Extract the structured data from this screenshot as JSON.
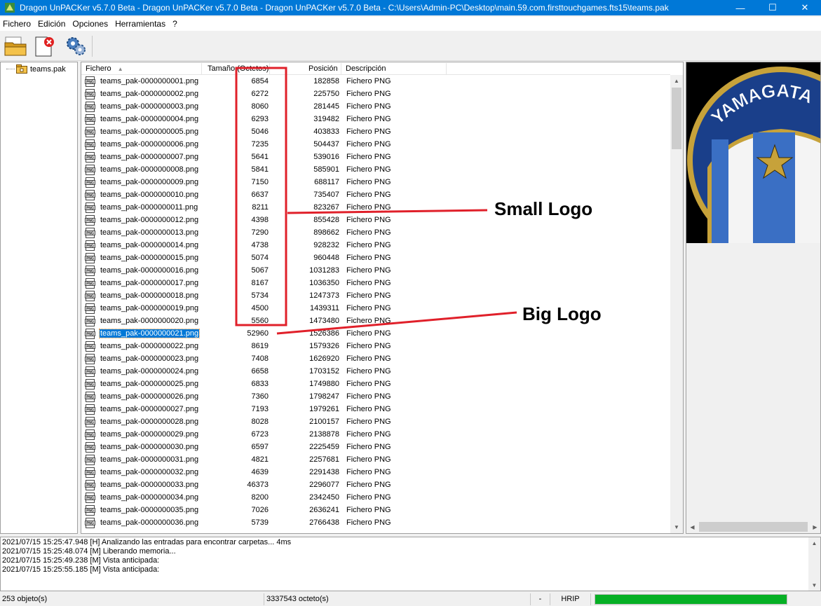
{
  "window": {
    "title": "Dragon UnPACKer v5.7.0 Beta - Dragon UnPACKer v5.7.0 Beta - Dragon UnPACKer v5.7.0 Beta - C:\\Users\\Admin-PC\\Desktop\\main.59.com.firsttouchgames.fts15\\teams.pak",
    "minimize": "—",
    "maximize": "☐",
    "close": "✕"
  },
  "menu": [
    "Fichero",
    "Edición",
    "Opciones",
    "Herramientas",
    "?"
  ],
  "toolbar": {
    "icons": [
      "open-folder-icon",
      "close-file-icon",
      "options-gear-icon"
    ]
  },
  "tree": {
    "root": "teams.pak"
  },
  "columns": {
    "name": "Fichero",
    "size": "Tamaño (Octetos)",
    "position": "Posición",
    "description": "Descripción"
  },
  "files": [
    {
      "name": "teams_pak-0000000001.png",
      "size": "6854",
      "pos": "182858",
      "desc": "Fichero PNG"
    },
    {
      "name": "teams_pak-0000000002.png",
      "size": "6272",
      "pos": "225750",
      "desc": "Fichero PNG"
    },
    {
      "name": "teams_pak-0000000003.png",
      "size": "8060",
      "pos": "281445",
      "desc": "Fichero PNG"
    },
    {
      "name": "teams_pak-0000000004.png",
      "size": "6293",
      "pos": "319482",
      "desc": "Fichero PNG"
    },
    {
      "name": "teams_pak-0000000005.png",
      "size": "5046",
      "pos": "403833",
      "desc": "Fichero PNG"
    },
    {
      "name": "teams_pak-0000000006.png",
      "size": "7235",
      "pos": "504437",
      "desc": "Fichero PNG"
    },
    {
      "name": "teams_pak-0000000007.png",
      "size": "5641",
      "pos": "539016",
      "desc": "Fichero PNG"
    },
    {
      "name": "teams_pak-0000000008.png",
      "size": "5841",
      "pos": "585901",
      "desc": "Fichero PNG"
    },
    {
      "name": "teams_pak-0000000009.png",
      "size": "7150",
      "pos": "688117",
      "desc": "Fichero PNG"
    },
    {
      "name": "teams_pak-0000000010.png",
      "size": "6637",
      "pos": "735407",
      "desc": "Fichero PNG"
    },
    {
      "name": "teams_pak-0000000011.png",
      "size": "8211",
      "pos": "823267",
      "desc": "Fichero PNG"
    },
    {
      "name": "teams_pak-0000000012.png",
      "size": "4398",
      "pos": "855428",
      "desc": "Fichero PNG"
    },
    {
      "name": "teams_pak-0000000013.png",
      "size": "7290",
      "pos": "898662",
      "desc": "Fichero PNG"
    },
    {
      "name": "teams_pak-0000000014.png",
      "size": "4738",
      "pos": "928232",
      "desc": "Fichero PNG"
    },
    {
      "name": "teams_pak-0000000015.png",
      "size": "5074",
      "pos": "960448",
      "desc": "Fichero PNG"
    },
    {
      "name": "teams_pak-0000000016.png",
      "size": "5067",
      "pos": "1031283",
      "desc": "Fichero PNG"
    },
    {
      "name": "teams_pak-0000000017.png",
      "size": "8167",
      "pos": "1036350",
      "desc": "Fichero PNG"
    },
    {
      "name": "teams_pak-0000000018.png",
      "size": "5734",
      "pos": "1247373",
      "desc": "Fichero PNG"
    },
    {
      "name": "teams_pak-0000000019.png",
      "size": "4500",
      "pos": "1439311",
      "desc": "Fichero PNG"
    },
    {
      "name": "teams_pak-0000000020.png",
      "size": "5560",
      "pos": "1473480",
      "desc": "Fichero PNG"
    },
    {
      "name": "teams_pak-0000000021.png",
      "size": "52960",
      "pos": "1526386",
      "desc": "Fichero PNG",
      "selected": true
    },
    {
      "name": "teams_pak-0000000022.png",
      "size": "8619",
      "pos": "1579326",
      "desc": "Fichero PNG"
    },
    {
      "name": "teams_pak-0000000023.png",
      "size": "7408",
      "pos": "1626920",
      "desc": "Fichero PNG"
    },
    {
      "name": "teams_pak-0000000024.png",
      "size": "6658",
      "pos": "1703152",
      "desc": "Fichero PNG"
    },
    {
      "name": "teams_pak-0000000025.png",
      "size": "6833",
      "pos": "1749880",
      "desc": "Fichero PNG"
    },
    {
      "name": "teams_pak-0000000026.png",
      "size": "7360",
      "pos": "1798247",
      "desc": "Fichero PNG"
    },
    {
      "name": "teams_pak-0000000027.png",
      "size": "7193",
      "pos": "1979261",
      "desc": "Fichero PNG"
    },
    {
      "name": "teams_pak-0000000028.png",
      "size": "8028",
      "pos": "2100157",
      "desc": "Fichero PNG"
    },
    {
      "name": "teams_pak-0000000029.png",
      "size": "6723",
      "pos": "2138878",
      "desc": "Fichero PNG"
    },
    {
      "name": "teams_pak-0000000030.png",
      "size": "6597",
      "pos": "2225459",
      "desc": "Fichero PNG"
    },
    {
      "name": "teams_pak-0000000031.png",
      "size": "4821",
      "pos": "2257681",
      "desc": "Fichero PNG"
    },
    {
      "name": "teams_pak-0000000032.png",
      "size": "4639",
      "pos": "2291438",
      "desc": "Fichero PNG"
    },
    {
      "name": "teams_pak-0000000033.png",
      "size": "46373",
      "pos": "2296077",
      "desc": "Fichero PNG"
    },
    {
      "name": "teams_pak-0000000034.png",
      "size": "8200",
      "pos": "2342450",
      "desc": "Fichero PNG"
    },
    {
      "name": "teams_pak-0000000035.png",
      "size": "7026",
      "pos": "2636241",
      "desc": "Fichero PNG"
    },
    {
      "name": "teams_pak-0000000036.png",
      "size": "5739",
      "pos": "2766438",
      "desc": "Fichero PNG"
    }
  ],
  "preview": {
    "logo_text": "YAMAGATA"
  },
  "log": [
    "2021/07/15 15:25:47.948 [H] Analizando las entradas para encontrar carpetas... 4ms",
    "2021/07/15 15:25:48.074 [M] Liberando memoria...",
    "2021/07/15 15:25:49.238 [M] Vista anticipada:",
    "2021/07/15 15:25:55.185 [M] Vista anticipada:"
  ],
  "status": {
    "objects": "253 objeto(s)",
    "bytes": "3337543 octeto(s)",
    "dash": "-",
    "plugin": "HRIP",
    "progress": 1.0
  },
  "annotations": {
    "small": "Small Logo",
    "big": "Big Logo",
    "color": "#e0202a"
  },
  "colors": {
    "titlebar": "#0078d7",
    "selection": "#0078d7",
    "progress": "#06b025"
  }
}
